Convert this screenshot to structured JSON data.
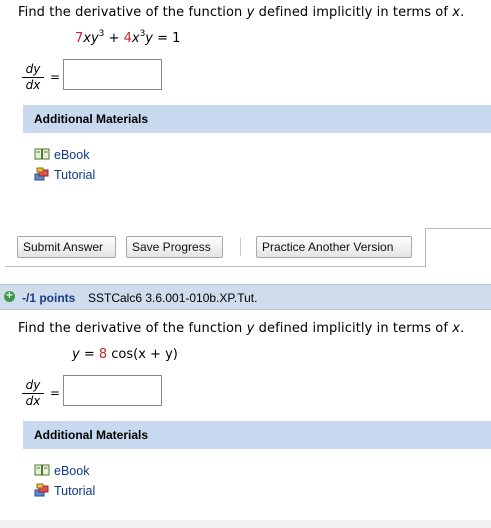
{
  "q1": {
    "prompt_a": "Find the derivative of the function ",
    "prompt_var": "y",
    "prompt_b": " defined implicitly in terms of ",
    "prompt_var2": "x",
    "prompt_end": ".",
    "eq": {
      "c1": "7",
      "t1a": "xy",
      "e1": "3",
      "plus": " + ",
      "c2": "4",
      "t2a": "x",
      "e2": "3",
      "t2b": "y",
      "rhs": " = 1"
    },
    "deriv_num": "dy",
    "deriv_den": "dx",
    "equals": "=",
    "answer_value": "",
    "additional_materials": "Additional Materials",
    "links": [
      "eBook",
      "Tutorial"
    ],
    "buttons": {
      "submit": "Submit Answer",
      "save": "Save Progress",
      "practice": "Practice Another Version"
    }
  },
  "q2": {
    "points": "-/1 points",
    "code": "SSTCalc6 3.6.001-010b.XP.Tut.",
    "prompt_a": "Find the derivative of the function ",
    "prompt_var": "y",
    "prompt_b": " defined implicitly in terms of ",
    "prompt_var2": "x",
    "prompt_end": ".",
    "eq": {
      "lhs": "y = ",
      "c1": "8",
      "rest": " cos(x + y)"
    },
    "deriv_num": "dy",
    "deriv_den": "dx",
    "equals": "=",
    "answer_value": "",
    "additional_materials": "Additional Materials",
    "links": [
      "eBook",
      "Tutorial"
    ]
  },
  "colors": {
    "accent_header": "#c8d8ee",
    "coefficient_red": "#c0282c",
    "link_blue": "#0a3a8a",
    "plus_green": "#3a9a4a"
  }
}
